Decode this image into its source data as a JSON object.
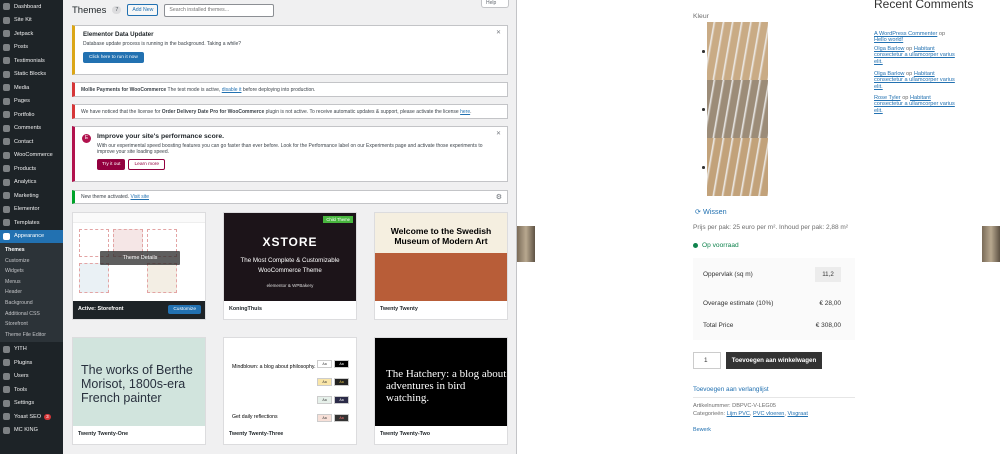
{
  "admin": {
    "sidebar": {
      "top_items": [
        {
          "label": "Dashboard"
        },
        {
          "label": "Site Kit"
        },
        {
          "label": "Jetpack"
        },
        {
          "label": "Posts"
        },
        {
          "label": "Testimonials"
        },
        {
          "label": "Static Blocks"
        },
        {
          "label": "Media"
        },
        {
          "label": "Pages"
        },
        {
          "label": "Portfolio"
        },
        {
          "label": "Comments"
        },
        {
          "label": "Contact"
        },
        {
          "label": "WooCommerce"
        },
        {
          "label": "Products"
        },
        {
          "label": "Analytics"
        },
        {
          "label": "Marketing"
        },
        {
          "label": "Elementor"
        },
        {
          "label": "Templates"
        },
        {
          "label": "Appearance"
        }
      ],
      "submenu": [
        "Themes",
        "Customize",
        "Widgets",
        "Menus",
        "Header",
        "Background",
        "Additional CSS",
        "Storefront",
        "Theme File Editor"
      ],
      "bottom_items": [
        {
          "label": "YITH"
        },
        {
          "label": "Plugins"
        },
        {
          "label": "Users"
        },
        {
          "label": "Tools"
        },
        {
          "label": "Settings"
        },
        {
          "label": "Yoast SEO",
          "badge": "3"
        },
        {
          "label": "MC KING"
        }
      ]
    },
    "header": {
      "title": "Themes",
      "count": "7",
      "add_new": "Add New",
      "search_placeholder": "Search installed themes...",
      "help": "Help"
    },
    "notices": {
      "elementor": {
        "title": "Elementor Data Updater",
        "text": "Database update process is running in the background. Taking a while?",
        "button": "Click here to run it now"
      },
      "mollie": {
        "strong": "Mollie Payments for WooCommerce",
        "text": " The test mode is active, ",
        "link": "disable it",
        "after": " before deploying into production."
      },
      "license": {
        "pre": "We have noticed that the license for ",
        "strong": "Order Delivery Date Pro for WooCommerce",
        "post": " plugin is not active. To receive automatic updates & support, please activate the license ",
        "link": "here",
        "end": "."
      },
      "performance": {
        "title": "Improve your site's performance score.",
        "text": "With our experimental speed boosting features you can go faster than ever before. Look for the Performance label on our Experiments page and activate those experiments to improve your site loading speed.",
        "try": "Try it out",
        "learn": "Learn more"
      },
      "activated": {
        "text": "New theme activated. ",
        "link": "Visit site"
      }
    },
    "themes": [
      {
        "name": "Storefront",
        "active_prefix": "Active:",
        "customize": "Customize",
        "details": "Theme Details"
      },
      {
        "name": "KoningThuis",
        "logo": "XSTORE",
        "line1": "The Most Complete & Customizable",
        "line2": "WooCommerce Theme",
        "foot": "elementor & WPBakery",
        "tag": "Child Theme"
      },
      {
        "name": "Twenty Twenty",
        "headline": "Welcome to the Swedish Museum of Modern Art"
      },
      {
        "name": "Twenty Twenty-One",
        "headline": "The works of Berthe Morisot, 1800s-era French painter"
      },
      {
        "name": "Twenty Twenty-Three",
        "headline": "Mindblown: a blog about philosophy.",
        "sub": "Get daily reflections"
      },
      {
        "name": "Twenty Twenty-Two",
        "headline": "The Hatchery: a blog about adventures in bird watching."
      }
    ]
  },
  "shop": {
    "kleur_label": "Kleur",
    "swatch_colors": [
      "#c9ab85",
      "#9c8c78",
      "#c2a27a"
    ],
    "wissen": "Wissen",
    "price_line": "Prijs per pak: 25 euro per m². Inhoud per pak: 2,88 m²",
    "stock": "Op voorraad",
    "calc": {
      "area_label": "Oppervlak (sq m)",
      "area_value": "11,2",
      "overage_label": "Overage estimate (10%)",
      "overage_value": "€ 28,00",
      "total_label": "Total Price",
      "total_value": "€ 308,00"
    },
    "qty": "1",
    "add_to_cart": "Toevoegen aan winkelwagen",
    "wishlist": "Toevoegen aan verlanglijst",
    "sku_label": "Artikelnummer: ",
    "sku": "DBPVC-V-LEG05",
    "cats_label": "Categorieën: ",
    "cats": [
      "Lijm PVC",
      "PVC vloeren",
      "Visgraat"
    ],
    "edit": "Bewerk"
  },
  "recent_comments": {
    "title": "Recent Comments",
    "items": [
      {
        "author": "A WordPress Commenter",
        "on": " op ",
        "post": "Hello world!"
      },
      {
        "author": "Olga Barlow",
        "on": " op ",
        "post": "Habitant consectetur a ullamcorper varius elit."
      },
      {
        "author": "Olga Barlow",
        "on": " op ",
        "post": "Habitant consectetur a ullamcorper varius elit."
      },
      {
        "author": "Rose Tyler",
        "on": " op ",
        "post": "Habitant consectetur a ullamcorper varius elit."
      }
    ]
  }
}
